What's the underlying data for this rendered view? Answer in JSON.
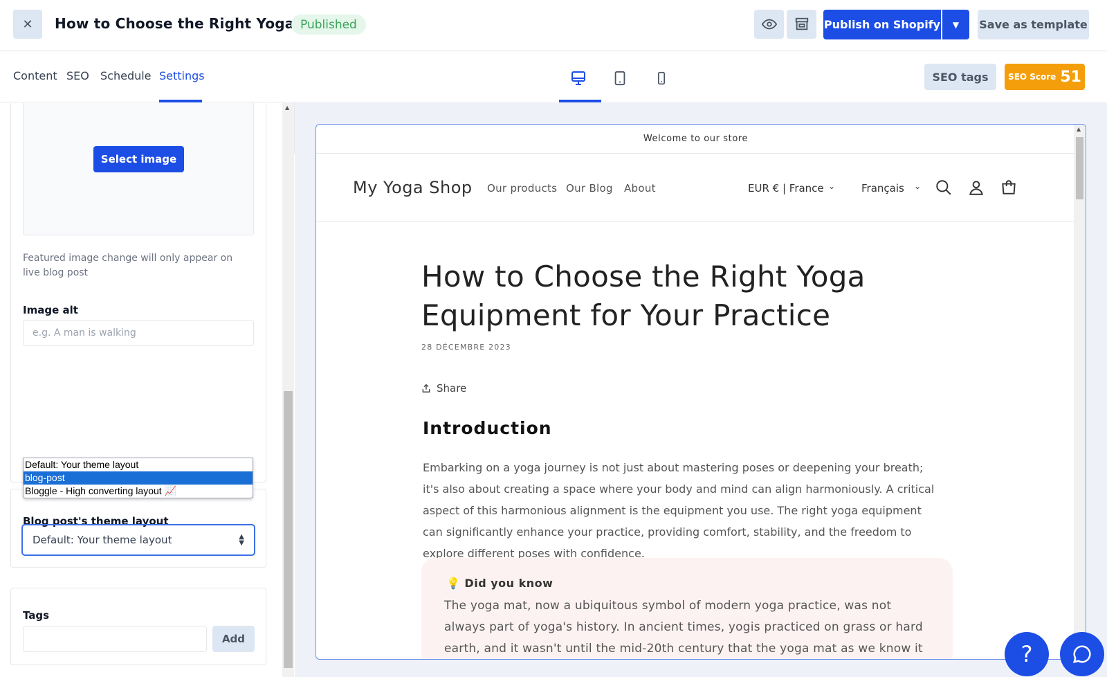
{
  "header": {
    "close_icon": "close-icon",
    "title": "How to Choose the Right Yoga ...",
    "status": "Published",
    "preview_icon": "eye-icon",
    "storefront_icon": "storefront-icon",
    "publish_label": "Publish on Shopify",
    "publish_dropdown_icon": "caret-down-icon",
    "save_template_label": "Save as template",
    "colors": {
      "primary": "#1c4ee6",
      "secondary_bg": "#dde6f3",
      "status_bg": "#e5f6ea",
      "status_text": "#3ba35b",
      "seo_score_bg": "#f59e0b"
    }
  },
  "tabs": [
    "Content",
    "SEO",
    "Schedule",
    "Settings"
  ],
  "active_tab": "Settings",
  "devices": [
    "desktop-icon",
    "tablet-icon",
    "mobile-icon"
  ],
  "active_device": "desktop",
  "seo": {
    "tags_label": "SEO tags",
    "score_label": "SEO Score",
    "score_value": "51"
  },
  "settings": {
    "select_image_label": "Select image",
    "featured_note": "Featured image change will only appear on live blog post",
    "image_alt_label": "Image alt",
    "image_alt_placeholder": "e.g. A man is walking",
    "layout_label": "Blog post's theme layout",
    "layout_value": "Default: Your theme layout",
    "layout_options": [
      "Default: Your theme layout",
      "blog-post",
      "Bloggle - High converting layout 📈"
    ],
    "layout_highlighted": "blog-post",
    "tags_label": "Tags",
    "tags_value": "",
    "tags_add_label": "Add"
  },
  "store": {
    "announcement": "Welcome to our store",
    "logo": "My Yoga Shop",
    "nav": [
      "Our products",
      "Our Blog",
      "About"
    ],
    "currency": "EUR € | France",
    "language": "Français",
    "icons": [
      "search-icon",
      "account-icon",
      "cart-icon"
    ]
  },
  "post": {
    "title": "How to Choose the Right Yoga Equipment for Your Practice",
    "date": "28 DÉCEMBRE 2023",
    "share_label": "Share",
    "intro_heading": "Introduction",
    "intro_body": "Embarking on a yoga journey is not just about mastering poses or deepening your breath; it's also about creating a space where your body and mind can align harmoniously. A critical aspect of this harmonious alignment is the equipment you use. The right yoga equipment can significantly enhance your practice, providing comfort, stability, and the freedom to explore different poses with confidence.",
    "tip_icon": "💡",
    "tip_title": "Did you know",
    "tip_body": "The yoga mat, now a ubiquitous symbol of modern yoga practice, was not always part of yoga's history. In ancient times, yogis practiced on grass or hard earth, and it wasn't until the mid-20th century that the yoga mat as we know it today was developed."
  },
  "support": {
    "help_label": "?",
    "chat_icon": "chat-icon"
  }
}
